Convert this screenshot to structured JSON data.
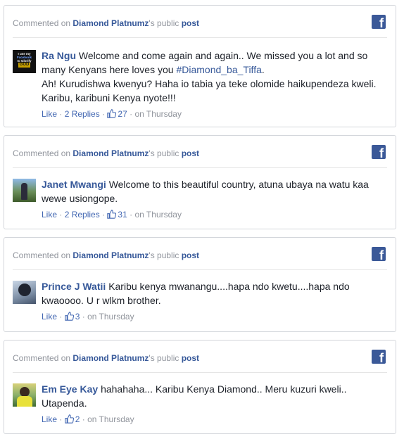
{
  "comments": [
    {
      "header_prefix": "Commented on ",
      "page_name": "Diamond Platnumz",
      "header_suffix": "'s public ",
      "post_link": "post",
      "commenter": "Ra Ngu",
      "text_before": "Welcome and come again and again.. We missed you a lot and so many Kenyans here loves you ",
      "hashtag": "#Diamond_ba_Tiffa",
      "text_after": ".",
      "text_line2": "Ah! Kurudishwa kwenyu? Haha io tabia ya teke olomide haikupendeza kweli. Karibu, karibuni Kenya nyote!!!",
      "avatar_text": "I use my Facebook to Glorify GOD",
      "like_label": "Like",
      "replies_label": "2 Replies",
      "likes_count": "27",
      "time_label": "on Thursday",
      "separator": "·"
    },
    {
      "header_prefix": "Commented on ",
      "page_name": "Diamond Platnumz",
      "header_suffix": "'s public ",
      "post_link": "post",
      "commenter": "Janet Mwangi",
      "text": "Welcome to this beautiful country, atuna ubaya na watu kaa wewe usiongope.",
      "like_label": "Like",
      "replies_label": "2 Replies",
      "likes_count": "31",
      "time_label": "on Thursday",
      "separator": "·"
    },
    {
      "header_prefix": "Commented on ",
      "page_name": "Diamond Platnumz",
      "header_suffix": "'s public ",
      "post_link": "post",
      "commenter": "Prince J Watii",
      "text": "Karibu kenya mwanangu....hapa ndo kwetu....hapa ndo kwaoooo. U r wlkm brother.",
      "like_label": "Like",
      "likes_count": "3",
      "time_label": "on Thursday",
      "separator": "·"
    },
    {
      "header_prefix": "Commented on ",
      "page_name": "Diamond Platnumz",
      "header_suffix": "'s public ",
      "post_link": "post",
      "commenter": "Em Eye Kay",
      "text": "hahahaha... Karibu Kenya Diamond.. Meru kuzuri kweli.. Utapenda.",
      "like_label": "Like",
      "likes_count": "2",
      "time_label": "on Thursday",
      "separator": "·"
    }
  ],
  "colors": {
    "facebook_blue": "#3b5998",
    "link_blue": "#365899",
    "muted_gray": "#90949c",
    "border": "#d3d6db"
  },
  "icons": {
    "brand": "facebook-icon",
    "like": "thumbs-up-icon"
  }
}
